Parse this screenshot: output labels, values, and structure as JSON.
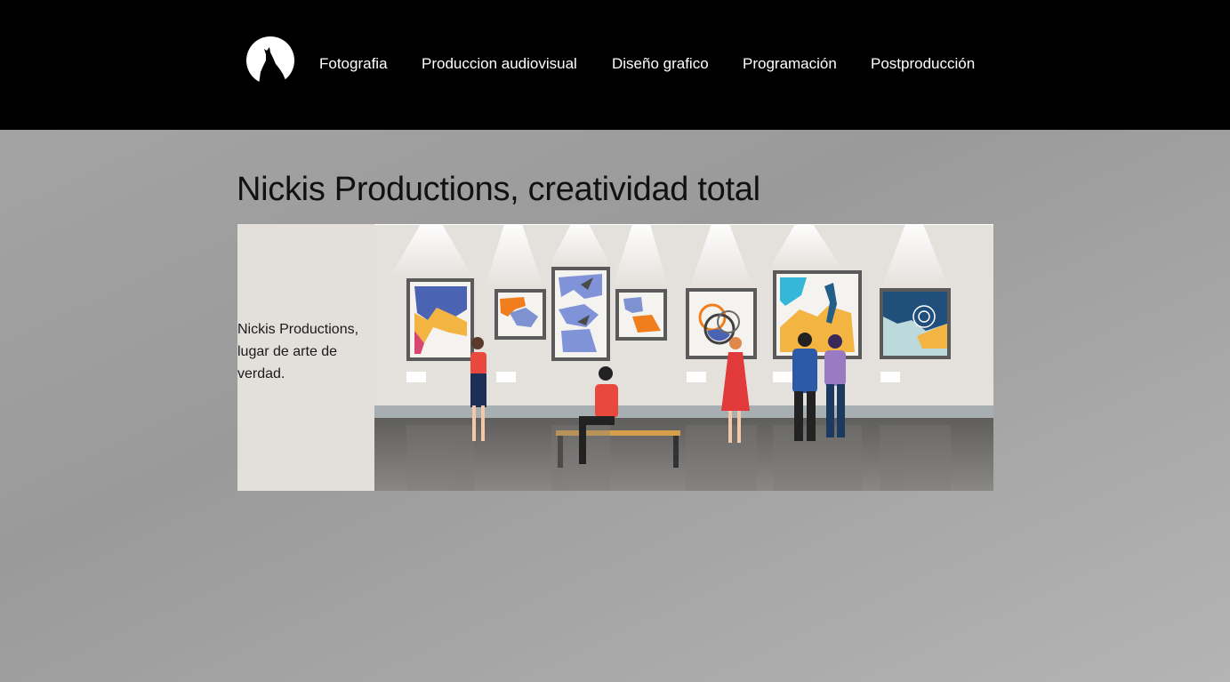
{
  "header": {
    "logo_icon": "wolf-howling-moon-icon",
    "nav": [
      {
        "label": "Fotografia"
      },
      {
        "label": "Produccion audiovisual"
      },
      {
        "label": "Diseño grafico"
      },
      {
        "label": "Programación"
      },
      {
        "label": "Postproducción"
      }
    ]
  },
  "main": {
    "title": "Nickis Productions, creatividad total",
    "hero_text": "Nickis Productions, lugar de arte de verdad.",
    "hero_image_icon": "art-gallery-illustration"
  },
  "colors": {
    "header_bg": "#000000",
    "page_bg": "#a0a0a0",
    "hero_bg": "#e3e0db"
  }
}
